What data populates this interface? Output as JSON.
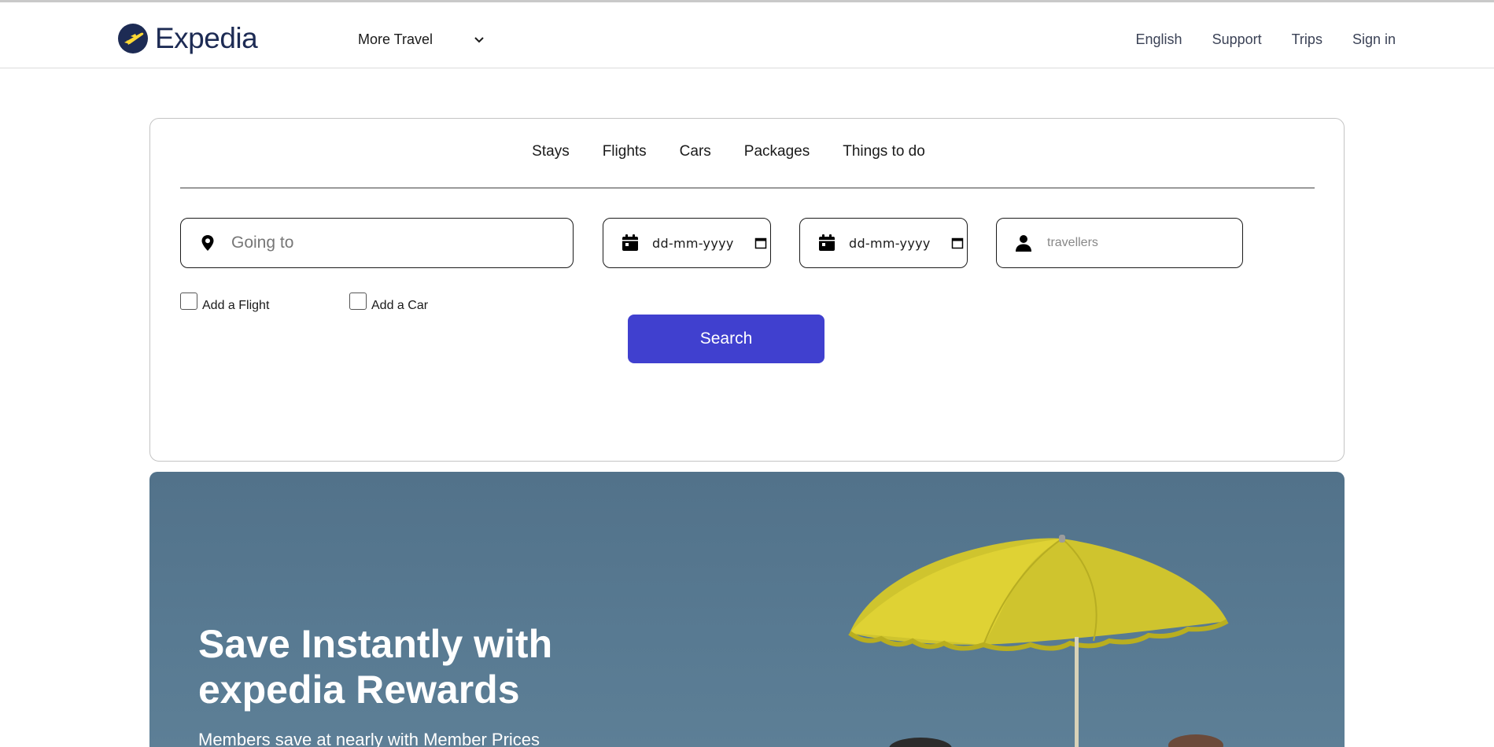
{
  "header": {
    "logo_text": "Expedia",
    "more_travel": "More Travel",
    "nav": [
      "English",
      "Support",
      "Trips",
      "Sign in"
    ]
  },
  "search": {
    "tabs": [
      "Stays",
      "Flights",
      "Cars",
      "Packages",
      "Things to do"
    ],
    "going_to_placeholder": "Going to",
    "checkin_placeholder": "dd-mm-yyyy",
    "checkout_placeholder": "dd-mm-yyyy",
    "travellers_placeholder": "travellers",
    "add_flight_label": "Add a Flight",
    "add_car_label": "Add a Car",
    "search_button": "Search"
  },
  "hero": {
    "title": "Save Instantly with expedia Rewards",
    "subtitle": "Members save at nearly with Member Prices"
  },
  "colors": {
    "brand_navy": "#1d2b54",
    "brand_yellow": "#fdd835",
    "search_button": "#4040cf",
    "hero_background": "#587a92"
  }
}
